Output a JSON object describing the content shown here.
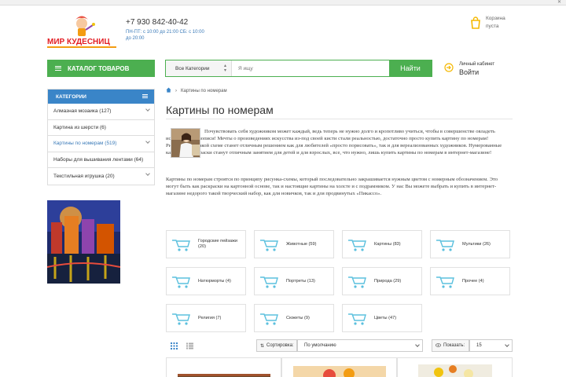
{
  "header": {
    "logo_text": "МИР КУДЕСНИЦ",
    "phone": "+7 930 842-40-42",
    "hours": "ПН-ПТ: с 10:00 до 21:00 СБ: с 10:00 до 20:00",
    "cart_line1": "Корзина",
    "cart_line2": "пуста"
  },
  "nav": {
    "catalog_label": "КАТАЛОГ ТОВАРОВ",
    "search_category": "Все Категории",
    "search_placeholder": "Я ищу",
    "search_button": "Найти",
    "login_line1": "Личный кабинет",
    "login_line2": "Войти"
  },
  "sidebar": {
    "title": "КАТЕГОРИИ",
    "items": [
      {
        "label": "Алмазная мозаика (127)"
      },
      {
        "label": "Картина из шерсти (6)"
      },
      {
        "label": "Картины по номерам (519)"
      },
      {
        "label": "Наборы для вышивания лентами (64)"
      },
      {
        "label": "Текстильная игрушка (20)"
      }
    ]
  },
  "breadcrumb": {
    "current": "Картины по номерам"
  },
  "main": {
    "title": "Картины по номерам",
    "intro_1": "Почувствовать себя художником может каждый, ведь теперь не нужно долго и кропотливо учиться, чтобы в совершенстве овладеть искусством живописи! Мечты о произведениях искусства из-под своей кисти стали реальностью, достаточно просто купить картину по номерам! Рисование по такой схеме станет отличным решением как для любителей «просто порисовать», так и для вереализованных художников. Нумерованные картины и раскраски станут отличным занятием для детей и для взрослых, все, что нужно, лишь купить картины по номерам в интернет-магазине!",
    "intro_2": "Картины по номерам строятся по принципу рисунка-схемы, который последовательно закрашивается нужным цветом с номерным обозначением. Это могут быть как раскраски на картонной основе, так и настоящие картины на холсте и с подрамником. У нас Вы можете выбрать и купить в интернет-магазине недорого такой творческий набор, как для новичков, так и для продвинутых «Пикассо».",
    "categories": [
      {
        "label": "Городские пейзажи (20)"
      },
      {
        "label": "Животные (59)"
      },
      {
        "label": "Картины (83)"
      },
      {
        "label": "Мультики (26)"
      },
      {
        "label": "Натюрморты (4)"
      },
      {
        "label": "Портреты (13)"
      },
      {
        "label": "Природа (29)"
      },
      {
        "label": "Прочее (4)"
      },
      {
        "label": "Религия (7)"
      },
      {
        "label": "Сюжеты (9)"
      },
      {
        "label": "Цветы (47)"
      }
    ]
  },
  "toolbar": {
    "sort_label": "Сортировка:",
    "sort_value": "По умолчанию",
    "show_label": "Показать:",
    "show_value": "15"
  },
  "colors": {
    "green": "#4caf50",
    "blue": "#3a85c8",
    "cart_icon": "#f5b800",
    "category_icon": "#5bc0de"
  }
}
